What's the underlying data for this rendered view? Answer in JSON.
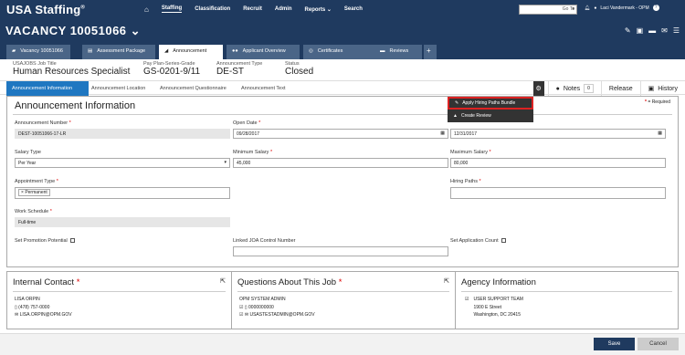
{
  "app": {
    "name": "USA Staffing",
    "reg": "®"
  },
  "nav": {
    "home_icon": "home-icon",
    "items": [
      "Staffing",
      "Classification",
      "Recruit",
      "Admin",
      "Reports ⌄",
      "Search"
    ]
  },
  "goto": {
    "placeholder": "Go To"
  },
  "user": {
    "name": "Laci Vandermark - OPM"
  },
  "vacancy": {
    "title": "VACANCY 10051066 ⌄"
  },
  "tabs": [
    "Vacancy 10051066",
    "Assessment Package",
    "Announcement",
    "Applicant Overview",
    "Certificates",
    "Reviews",
    "+"
  ],
  "info": [
    {
      "label": "USAJOBS Job Title",
      "value": "Human Resources Specialist"
    },
    {
      "label": "Pay Plan-Series-Grade",
      "value": "GS-0201-9/11"
    },
    {
      "label": "Announcement Type",
      "value": "DE-ST"
    },
    {
      "label": "Status",
      "value": "Closed"
    }
  ],
  "crumbs": [
    "Announcement Information",
    "Announcement Location",
    "Announcement Questionnaire",
    "Announcement Text"
  ],
  "actions": {
    "notes": "Notes",
    "notes_count": "0",
    "release": "Release",
    "history": "History"
  },
  "dropdown": {
    "apply": "Apply Hiring Paths Bundle",
    "create": "Create Review"
  },
  "section": {
    "title": "Announcement Information",
    "required_note": "= Required",
    "required_star": "*"
  },
  "fields": {
    "ann_number": {
      "label": "Announcement Number",
      "value": "DEST-10051066-17-LR"
    },
    "open_date": {
      "label": "Open Date",
      "value": "09/28/2017"
    },
    "close_date": {
      "value": "12/31/2017"
    },
    "salary_type": {
      "label": "Salary Type",
      "value": "Per Year"
    },
    "min_salary": {
      "label": "Minimum Salary",
      "value": "45,000"
    },
    "max_salary": {
      "label": "Maximum Salary",
      "value": "80,000"
    },
    "appt_type": {
      "label": "Appointment Type",
      "value": "Permanent"
    },
    "hiring_paths": {
      "label": "Hiring Paths"
    },
    "work_schedule": {
      "label": "Work Schedule",
      "value": "Full-time"
    },
    "promo": {
      "label": "Set Promotion Potential"
    },
    "linked_joa": {
      "label": "Linked JOA Control Number"
    },
    "app_count": {
      "label": "Set Application Count"
    }
  },
  "contact": {
    "title": "Internal Contact",
    "name": "LISA ORPIN",
    "phone": "(478) 757-0000",
    "email": "LISA.ORPIN@OPM.GOV"
  },
  "questions": {
    "title": "Questions About This Job",
    "name": "OPM SYSTEM ADMIN",
    "phone": "0000000000",
    "email": "USASTESTADMIN@OPM.GOV"
  },
  "agency": {
    "title": "Agency Information",
    "name": "USER SUPPORT TEAM",
    "addr1": "1900 E Street",
    "addr2": "Washington, DC 20415"
  },
  "footer": {
    "save": "Save",
    "cancel": "Cancel"
  }
}
